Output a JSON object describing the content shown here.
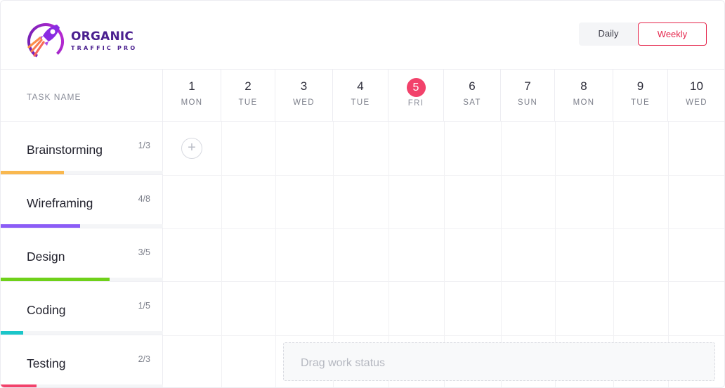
{
  "brand": {
    "title": "ORGANIC",
    "subtitle": "TRAFFIC PRO",
    "logo_icon": "rocket-icon",
    "colors": {
      "primary": "#4a1f8f",
      "accent": "#e5254b"
    }
  },
  "view_toggle": {
    "daily_label": "Daily",
    "weekly_label": "Weekly",
    "selected": "Weekly"
  },
  "grid": {
    "task_header": "TASK NAME",
    "days": [
      {
        "num": "1",
        "name": "MON",
        "today": false
      },
      {
        "num": "2",
        "name": "TUE",
        "today": false
      },
      {
        "num": "3",
        "name": "WED",
        "today": false
      },
      {
        "num": "4",
        "name": "TUE",
        "today": false
      },
      {
        "num": "5",
        "name": "FRI",
        "today": true
      },
      {
        "num": "6",
        "name": "SAT",
        "today": false
      },
      {
        "num": "7",
        "name": "SUN",
        "today": false
      },
      {
        "num": "8",
        "name": "MON",
        "today": false
      },
      {
        "num": "9",
        "name": "TUE",
        "today": false
      },
      {
        "num": "10",
        "name": "WED",
        "today": false
      }
    ],
    "tasks": [
      {
        "name": "Brainstorming",
        "count": "1/3",
        "progress": 0.39,
        "color": "#f9b84f"
      },
      {
        "name": "Wireframing",
        "count": "4/8",
        "progress": 0.49,
        "color": "#8b5cf6"
      },
      {
        "name": "Design",
        "count": "3/5",
        "progress": 0.67,
        "color": "#6fd11a"
      },
      {
        "name": "Coding",
        "count": "1/5",
        "progress": 0.14,
        "color": "#1bc6c9"
      },
      {
        "name": "Testing",
        "count": "2/3",
        "progress": 0.22,
        "color": "#f2426b"
      }
    ],
    "add_icon": "plus-circle-icon",
    "drop_zone_text": "Drag work status"
  }
}
